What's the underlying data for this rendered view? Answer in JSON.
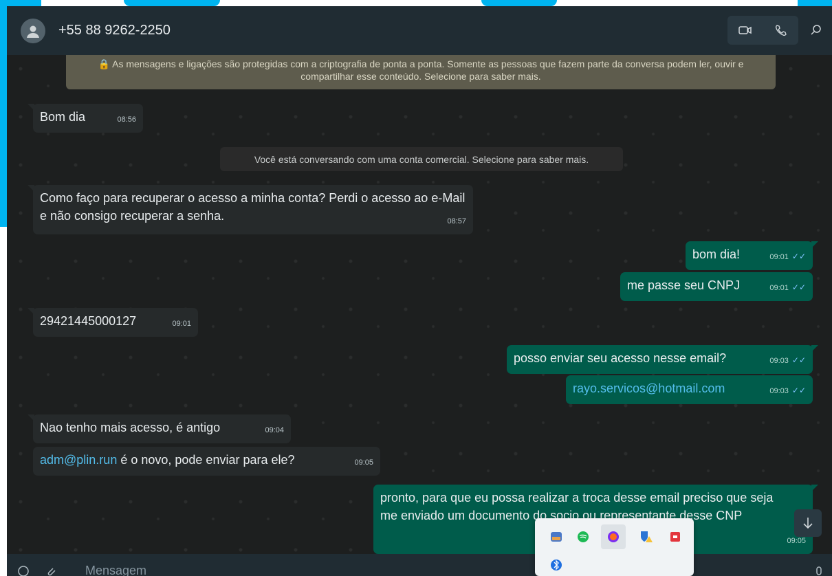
{
  "header": {
    "contact_name": "+55 88 9262-2250",
    "icons": [
      "avatar-icon",
      "video-call-icon",
      "voice-call-icon",
      "search-icon"
    ]
  },
  "chat": {
    "encryption_notice": "🔒 As mensagens e ligações são protegidas com a criptografia de ponta a ponta. Somente as pessoas que fazem parte da conversa podem ler, ouvir e compartilhar esse conteúdo. Selecione para saber mais.",
    "business_notice": "Você está conversando com uma conta comercial. Selecione para saber mais.",
    "messages": [
      {
        "dir": "in",
        "text": "Bom dia",
        "time": "08:56"
      },
      {
        "dir": "in",
        "text": "Como faço para recuperar o acesso a minha conta? Perdi o acesso ao e-Mail e não consigo recuperar a senha.",
        "time": "08:57"
      },
      {
        "dir": "out",
        "text": "bom dia!",
        "time": "09:01"
      },
      {
        "dir": "out",
        "text": "me passe seu CNPJ",
        "time": "09:01"
      },
      {
        "dir": "in",
        "text": "29421445000127",
        "time": "09:01"
      },
      {
        "dir": "out",
        "text": "posso enviar seu acesso nesse email?",
        "time": "09:03"
      },
      {
        "dir": "out",
        "text": "rayo.servicos@hotmail.com",
        "time": "09:03"
      },
      {
        "dir": "in",
        "text": "Nao tenho mais acesso, é antigo",
        "time": "09:04"
      },
      {
        "dir": "in",
        "link": "adm@plin.run",
        "text": " é o novo, pode enviar para ele?",
        "time": "09:05"
      },
      {
        "dir": "out",
        "text": "pronto, para que eu possa realizar a troca desse email preciso que seja me enviado um documento do socio ou representante desse CNP",
        "time": "09:05"
      }
    ]
  },
  "composer": {
    "placeholder": "Mensagem",
    "icons": [
      "emoji-icon",
      "attach-icon",
      "mic-icon"
    ]
  },
  "tray": {
    "icons": [
      "app-icon",
      "spotify-icon",
      "firefox-icon",
      "security-warning-icon",
      "media-icon",
      "bluetooth-icon"
    ]
  },
  "colors": {
    "header": "#202c33",
    "outgoing": "#005c4b",
    "incoming": "#262a2b",
    "link": "#53bdeb",
    "accent_bg": "#00b4f0"
  }
}
